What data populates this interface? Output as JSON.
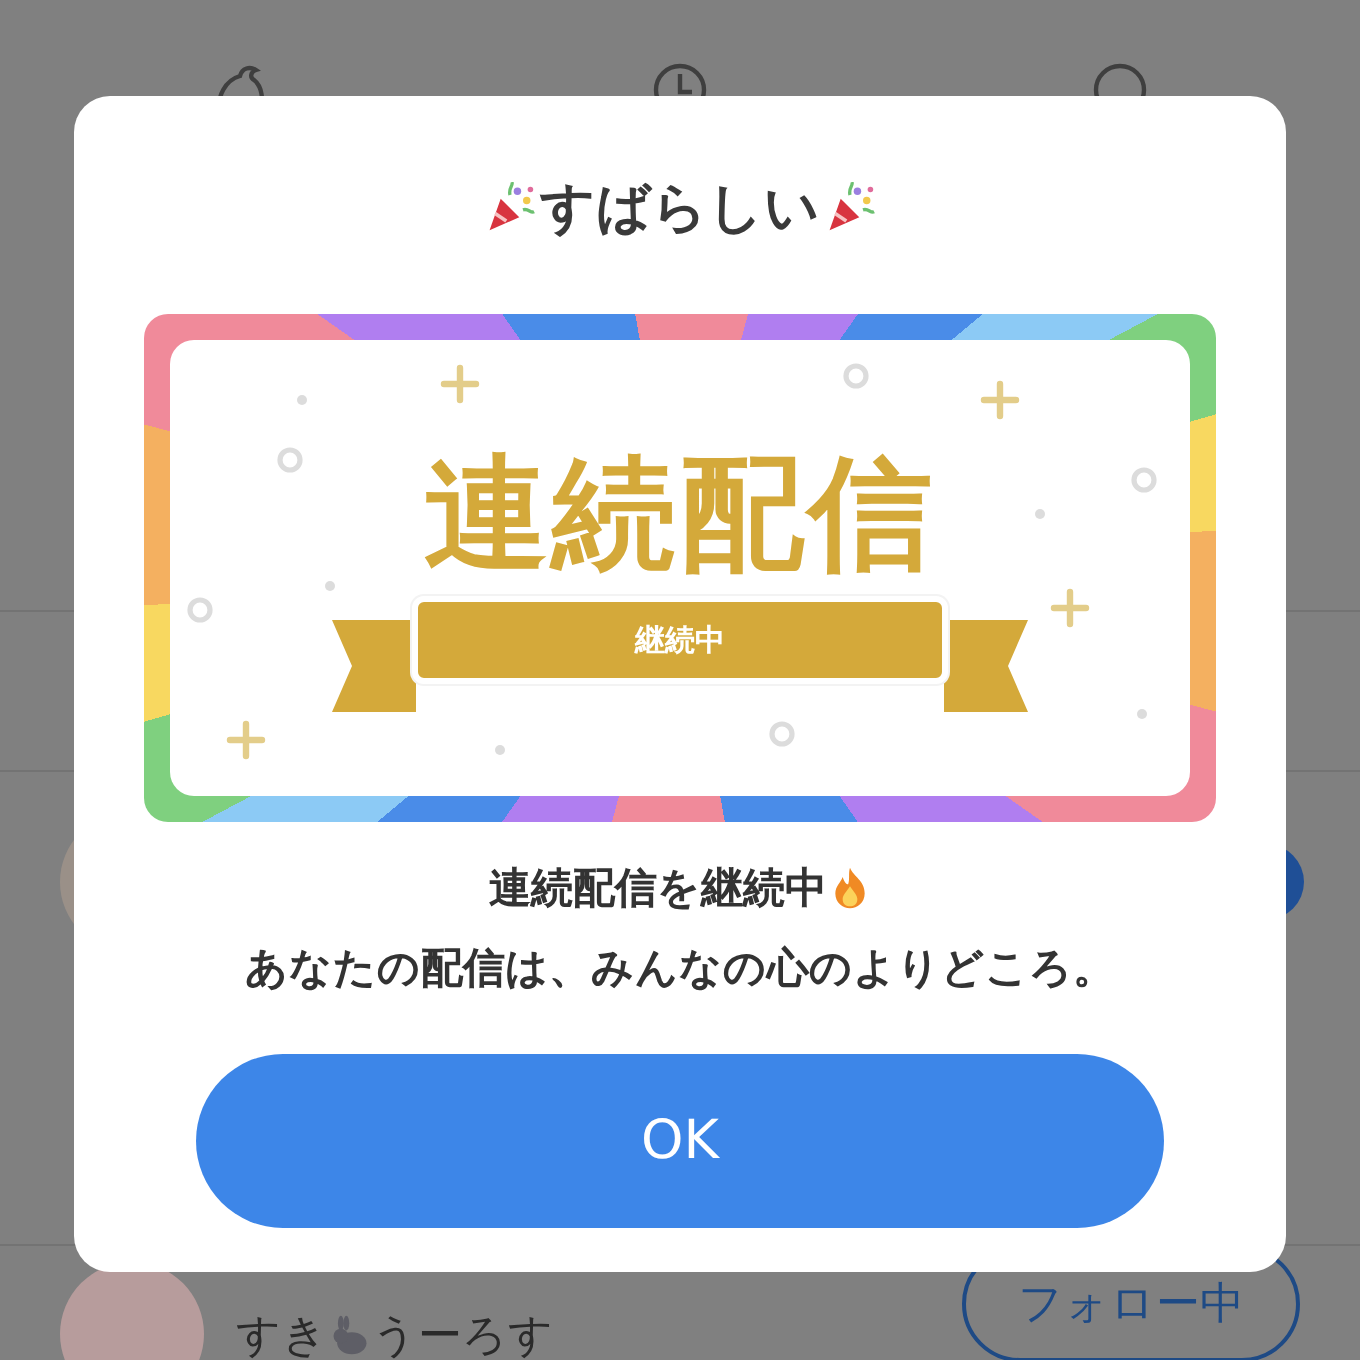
{
  "dialog": {
    "title": "すばらしい",
    "badge": {
      "title": "連続配信",
      "ribbon": "継続中"
    },
    "message": [
      "連続配信を継続中",
      "あなたの配信は、みんなの心のよりどころ。"
    ],
    "button": "OK"
  },
  "background": {
    "user": {
      "name_start": "すき",
      "name_end": "うーろす",
      "follow_button": "フォロー中"
    }
  }
}
